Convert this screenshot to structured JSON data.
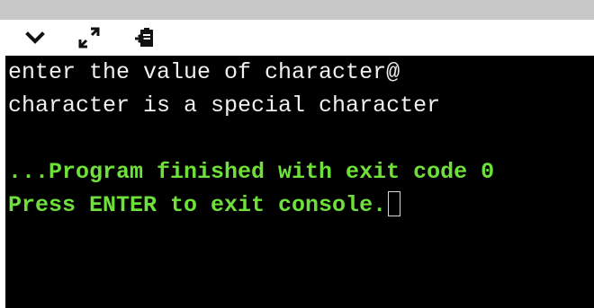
{
  "toolbar": {
    "buttons": [
      {
        "icon": "chevron-down-icon"
      },
      {
        "icon": "expand-icon"
      },
      {
        "icon": "clipboard-icon"
      }
    ]
  },
  "console": {
    "output_lines": [
      "enter the value of character@",
      "character is a special character"
    ],
    "status_lines": [
      "...Program finished with exit code 0",
      "Press ENTER to exit console."
    ]
  },
  "colors": {
    "console_background": "#000000",
    "output_text": "#f0f0f0",
    "status_text": "#6ee03a",
    "top_strip": "#c8c8c8"
  }
}
